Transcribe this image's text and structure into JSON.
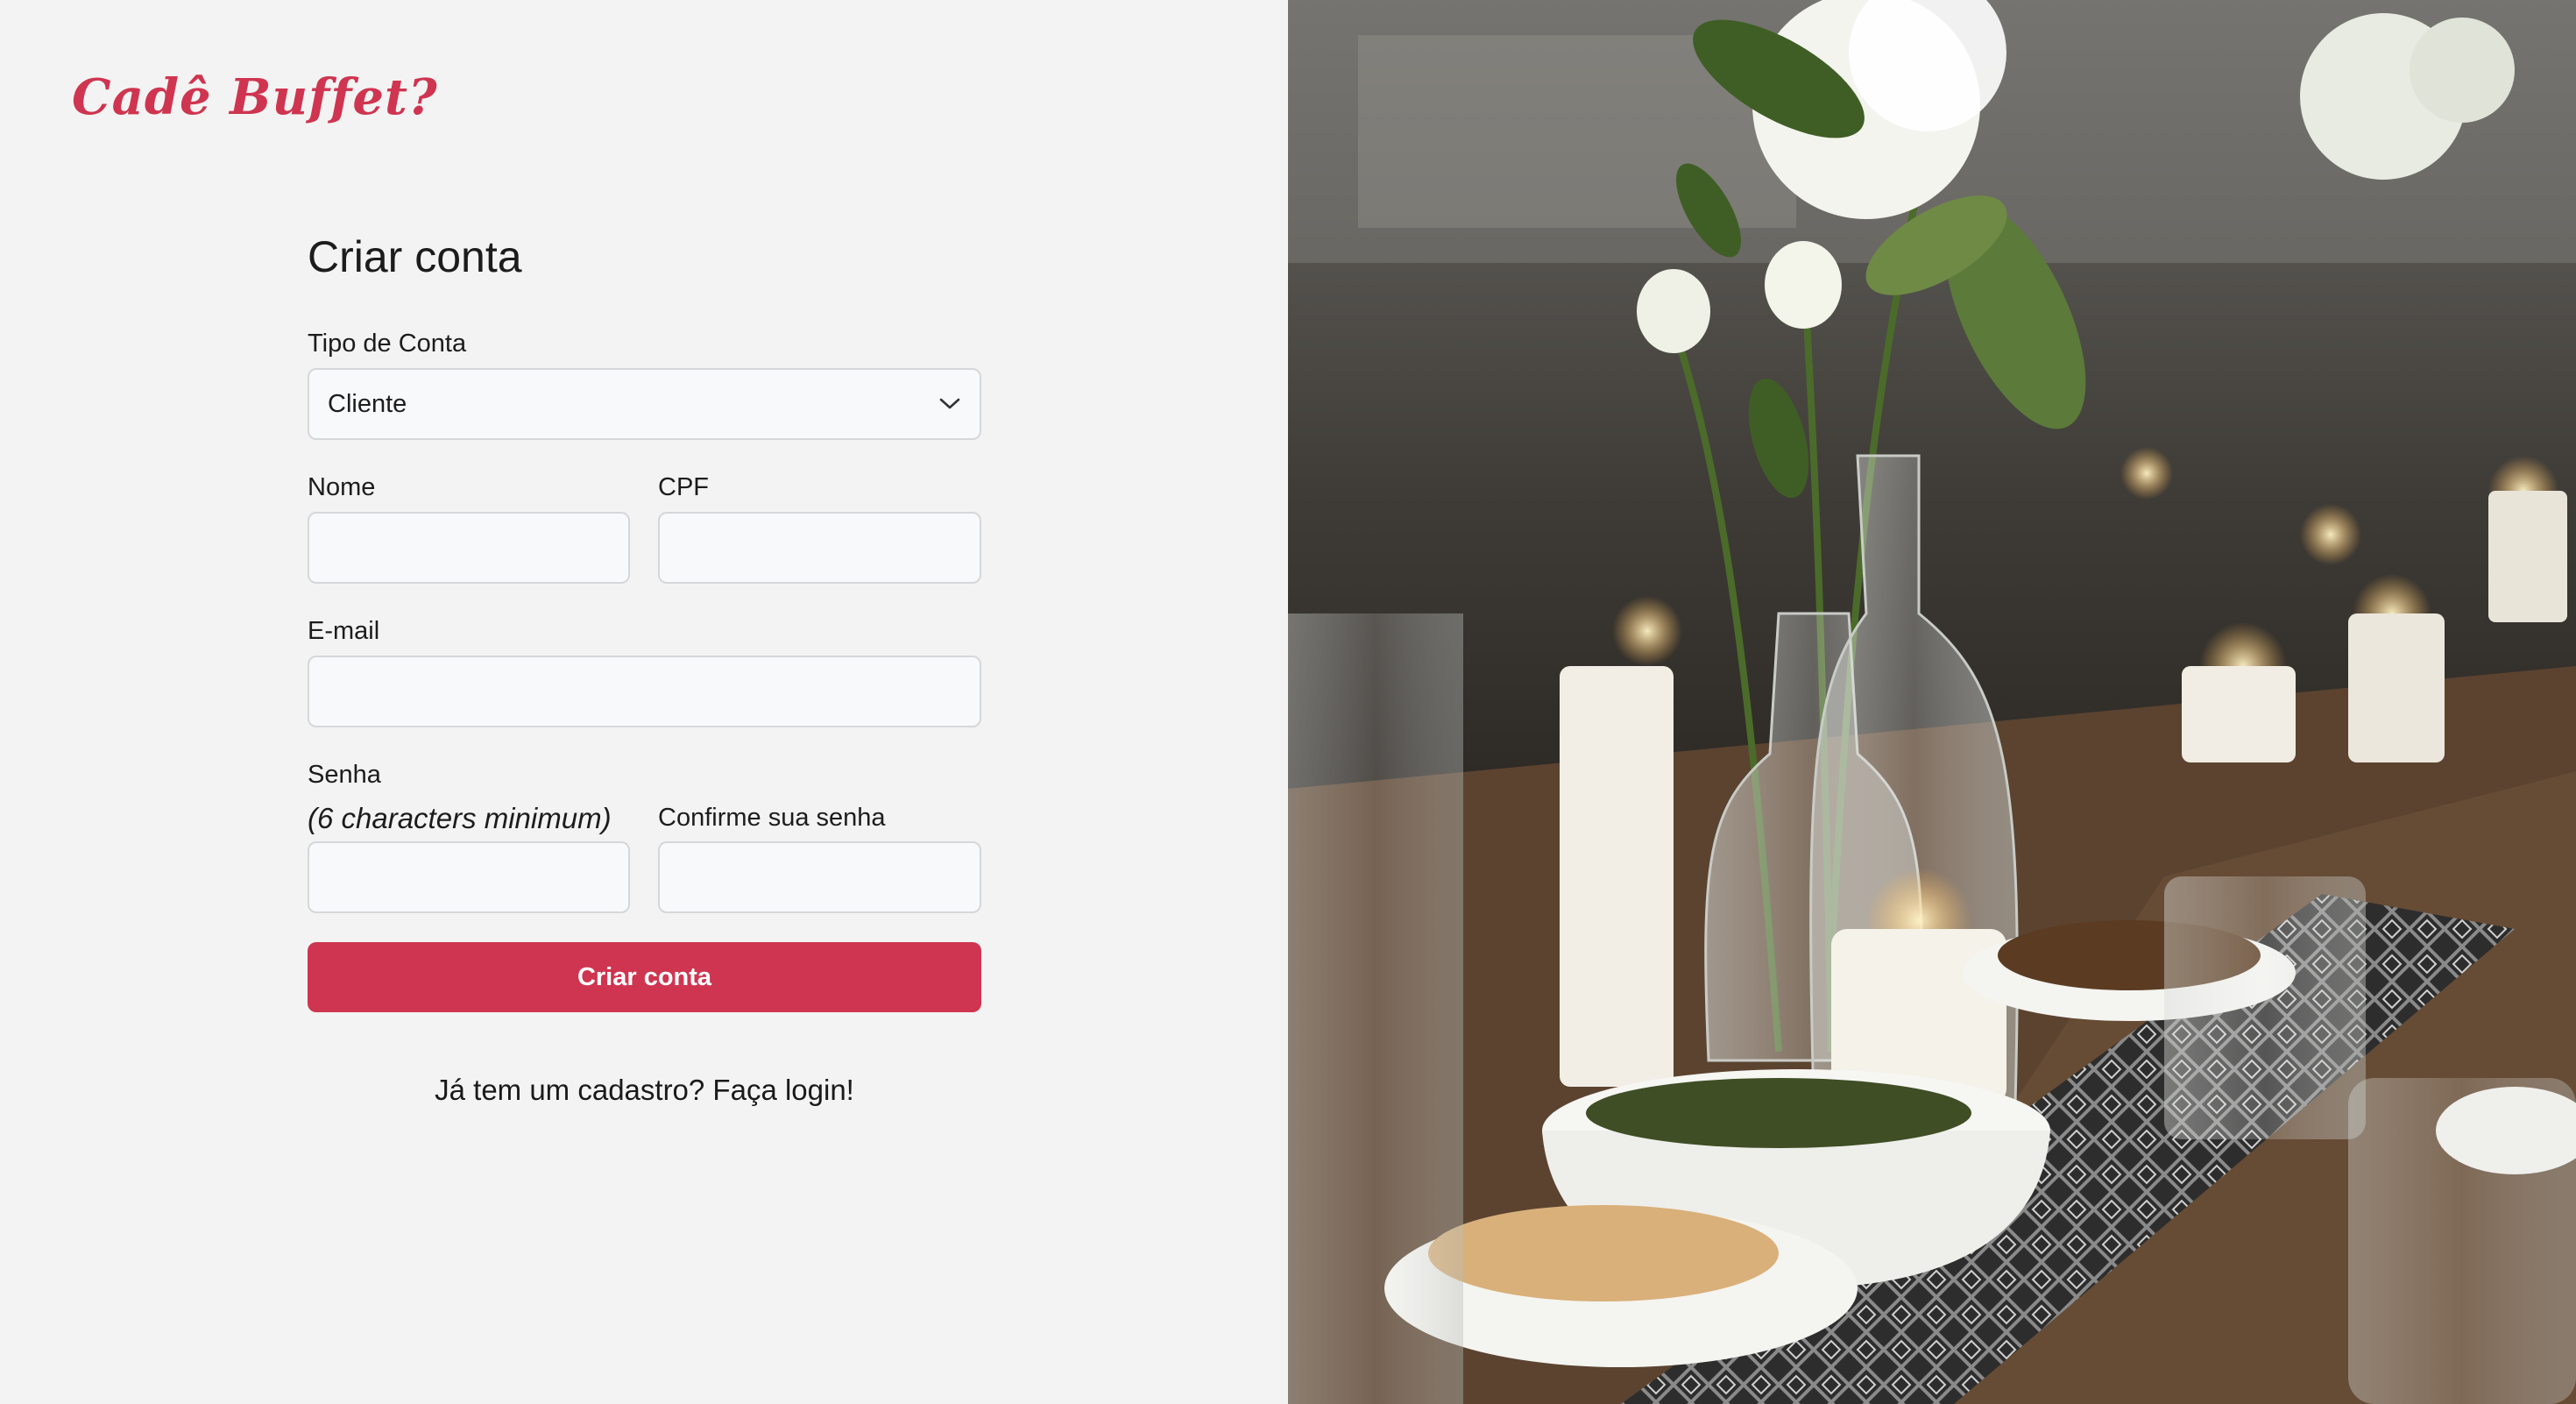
{
  "brand": {
    "logo_text": "Cadê Buffet?",
    "accent_color": "#cf3550"
  },
  "form": {
    "title": "Criar conta",
    "account_type": {
      "label": "Tipo de Conta",
      "value": "Cliente"
    },
    "name": {
      "label": "Nome",
      "value": ""
    },
    "cpf": {
      "label": "CPF",
      "value": ""
    },
    "email": {
      "label": "E-mail",
      "value": ""
    },
    "password": {
      "label": "Senha",
      "hint": "(6 characters minimum)",
      "value": ""
    },
    "password_confirm": {
      "label": "Confirme sua senha",
      "value": ""
    },
    "submit_label": "Criar conta",
    "login_link": "Já tem um cadastro? Faça login!"
  },
  "hero_image": {
    "icon": "table-setting-photo"
  }
}
